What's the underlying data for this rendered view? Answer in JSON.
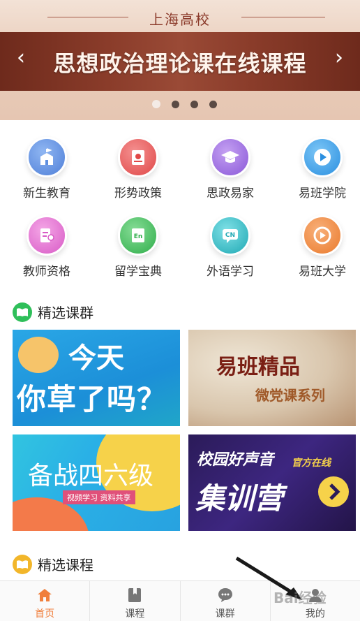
{
  "banner": {
    "school": "上海高校",
    "headline": "思想政治理论课在线课程",
    "prev": "‹",
    "next": "›",
    "slide_count": 4,
    "active_slide": 1
  },
  "grid": {
    "items": [
      {
        "label": "新生教育",
        "icon": "school-building-icon",
        "color": "#5f8fe0"
      },
      {
        "label": "形势政策",
        "icon": "red-book-icon",
        "color": "#e85a5a"
      },
      {
        "label": "思政易家",
        "icon": "graduation-cap-icon",
        "color": "#9b6be0"
      },
      {
        "label": "易班学院",
        "icon": "play-circle-icon",
        "color": "#2f9fe8"
      },
      {
        "label": "教师资格",
        "icon": "certificate-icon",
        "color": "#e46fd0"
      },
      {
        "label": "留学宝典",
        "icon": "english-book-icon",
        "color": "#3fbf5b"
      },
      {
        "label": "外语学习",
        "icon": "cn-chat-icon",
        "color": "#27b8c2"
      },
      {
        "label": "易班大学",
        "icon": "play-swirl-icon",
        "color": "#f08a3a"
      }
    ]
  },
  "sections": {
    "groups_title": "精选课群",
    "courses_title": "精选课程"
  },
  "cards": {
    "c1": {
      "line1": "今天",
      "line2": "你草了吗？"
    },
    "c2": {
      "line1": "易班精品",
      "line2": "微党课系列"
    },
    "c3": {
      "line1": "备战四六级",
      "tag": "视频学习  资料共享"
    },
    "c4": {
      "line1": "校园好声音",
      "line2": "集训营",
      "tag": "官方在线"
    }
  },
  "tabbar": {
    "tabs": [
      {
        "label": "首页",
        "icon": "home-icon",
        "active": true
      },
      {
        "label": "课程",
        "icon": "bookmark-book-icon",
        "active": false
      },
      {
        "label": "课群",
        "icon": "chat-bubble-icon",
        "active": false
      },
      {
        "label": "我的",
        "icon": "user-icon",
        "active": false
      }
    ]
  },
  "watermark": "Bai经验",
  "colors": {
    "accent": "#f07f3c",
    "banner_dark": "#8a3c2a"
  }
}
